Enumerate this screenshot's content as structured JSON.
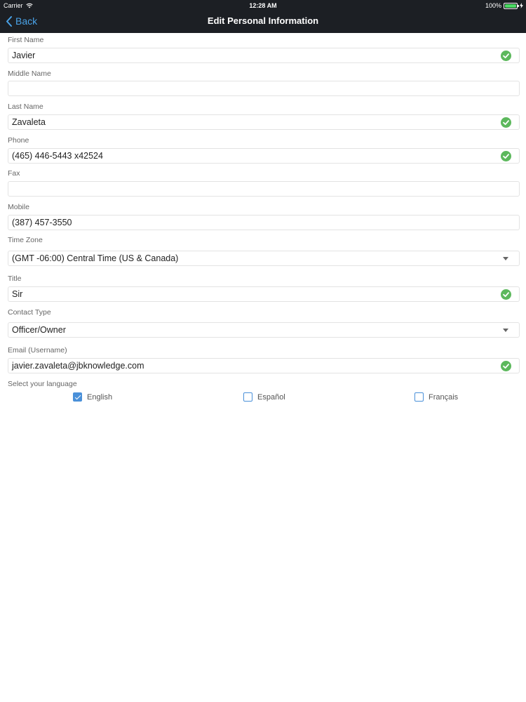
{
  "status_bar": {
    "carrier": "Carrier",
    "time": "12:28 AM",
    "battery": "100%",
    "battery_level": 1.0
  },
  "nav": {
    "back_label": "Back",
    "title": "Edit Personal Information"
  },
  "fields": [
    {
      "label": "First Name",
      "value": "Javier",
      "valid": true,
      "type": "text"
    },
    {
      "label": "Middle Name",
      "value": "",
      "valid": false,
      "type": "text"
    },
    {
      "label": "Last Name",
      "value": "Zavaleta",
      "valid": true,
      "type": "text"
    },
    {
      "label": "Phone",
      "value": "(465) 446-5443 x42524",
      "valid": true,
      "type": "text"
    },
    {
      "label": "Fax",
      "value": "",
      "valid": false,
      "type": "text"
    },
    {
      "label": "Mobile",
      "value": "(387) 457-3550",
      "valid": false,
      "type": "text"
    },
    {
      "label": "Time Zone",
      "value": "(GMT -06:00) Central Time (US & Canada)",
      "valid": false,
      "type": "select"
    },
    {
      "label": "Title",
      "value": "Sir",
      "valid": true,
      "type": "text"
    },
    {
      "label": "Contact Type",
      "value": "Officer/Owner",
      "valid": false,
      "type": "select"
    },
    {
      "label": "Email (Username)",
      "value": "javier.zavaleta@jbknowledge.com",
      "valid": true,
      "type": "text"
    }
  ],
  "language": {
    "label": "Select your language",
    "options": [
      {
        "label": "English",
        "checked": true
      },
      {
        "label": "Español",
        "checked": false
      },
      {
        "label": "Français",
        "checked": false
      }
    ]
  },
  "colors": {
    "header_bg": "#1c1f24",
    "accent": "#4aa3e8",
    "check_green": "#5cb85c",
    "checkbox_blue": "#4a90d9"
  },
  "icons": {
    "back": "chevron-left-icon",
    "valid": "check-circle-icon",
    "dropdown": "caret-down-icon",
    "wifi": "wifi-icon",
    "battery": "battery-icon"
  }
}
